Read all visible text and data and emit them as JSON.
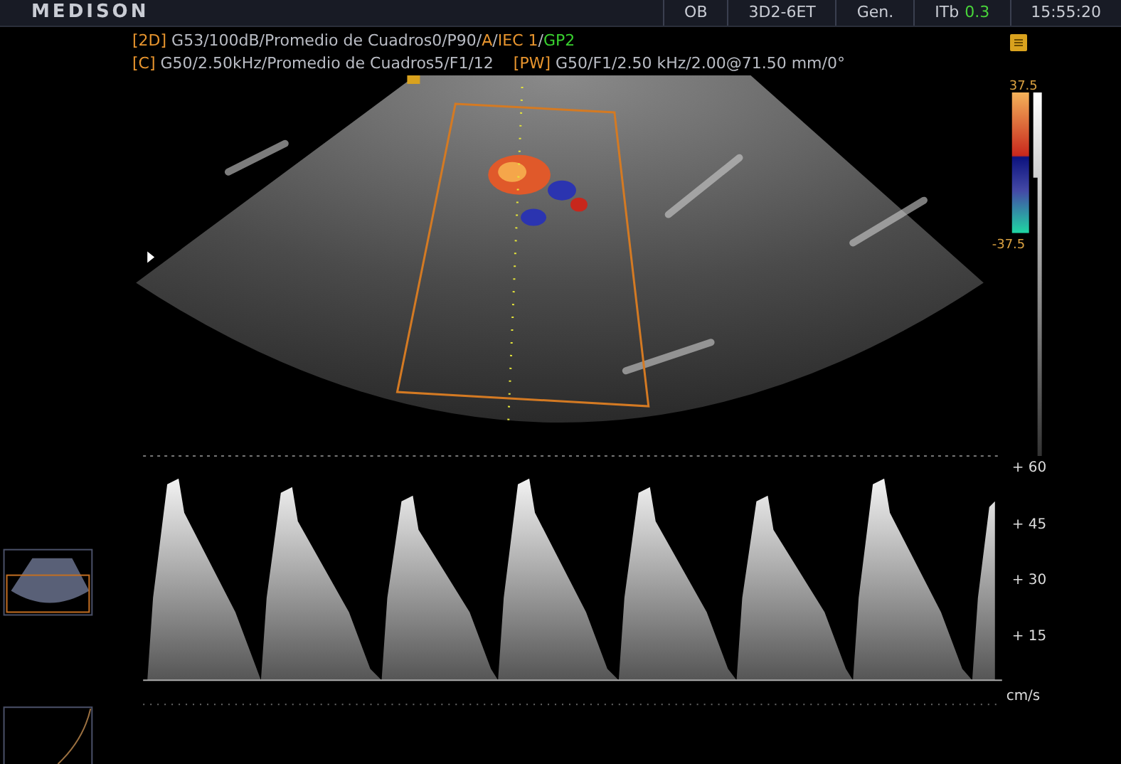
{
  "header": {
    "logo": "MEDISON",
    "items": [
      {
        "label": "OB"
      },
      {
        "label": "3D2-6ET"
      },
      {
        "label": "Gen."
      },
      {
        "label": "ITb",
        "value": "0.3"
      },
      {
        "label": "15:55:20"
      }
    ]
  },
  "parameter_lines": [
    [
      [
        {
          "text": "[2D]",
          "kind": "tag"
        },
        {
          "text": " G53/100dB/Promedio de Cuadros0/P90/",
          "kind": "plain"
        },
        {
          "text": "A",
          "kind": "tag"
        },
        {
          "text": "/",
          "kind": "plain"
        },
        {
          "text": "IEC 1",
          "kind": "tag"
        },
        {
          "text": "/",
          "kind": "plain"
        },
        {
          "text": "GP2",
          "kind": "ok"
        }
      ]
    ],
    [
      [
        {
          "text": "[C]",
          "kind": "tag"
        },
        {
          "text": " G50/2.50kHz/Promedio de Cuadros5/F1/12",
          "kind": "plain"
        }
      ],
      [
        {
          "text": "[PW]",
          "kind": "tag"
        },
        {
          "text": " G50/F1/2.50 kHz/2.00@71.50 mm/0°",
          "kind": "plain"
        }
      ]
    ]
  ],
  "color_scale": {
    "max": "37.5",
    "min": "-37.5"
  },
  "velocity_scale": {
    "ticks": [
      "+ 60",
      "+ 45",
      "+ 30",
      "+ 15"
    ],
    "unit": "cm/s"
  }
}
